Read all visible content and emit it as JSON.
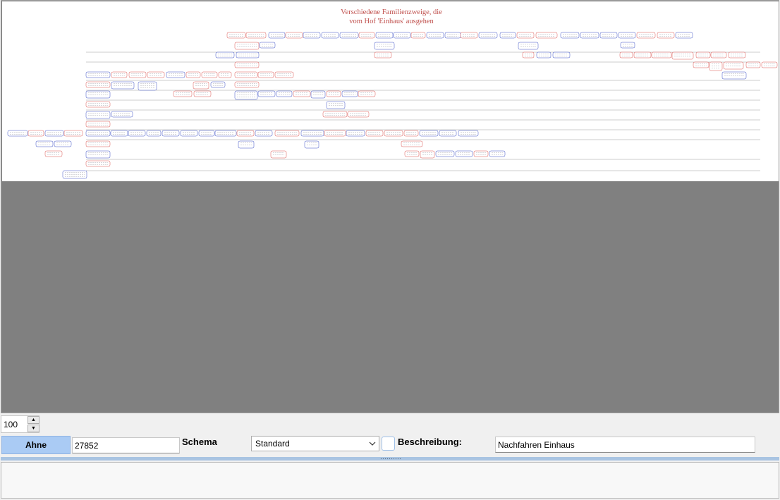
{
  "tree": {
    "title_line1": "Verschiedene Familienzweige, die",
    "title_line2": "vom Hof 'Einhaus' ausgehen",
    "colors": {
      "title": "#c0504d",
      "male_box": "#3a4fc4",
      "female_box": "#d9534f",
      "line": "#9a9a9a",
      "canvas_background": "#808080"
    }
  },
  "controls": {
    "zoom_value": "100",
    "spin_up_icon": "up-arrow-icon",
    "spin_down_icon": "down-arrow-icon",
    "ahne_button": "Ahne",
    "ahne_id": "27852",
    "schema_label": "Schema",
    "schema_value": "Standard",
    "beschreibung_label": "Beschreibung:",
    "beschreibung_value": "Nachfahren Einhaus"
  },
  "notes": {
    "text": ""
  }
}
